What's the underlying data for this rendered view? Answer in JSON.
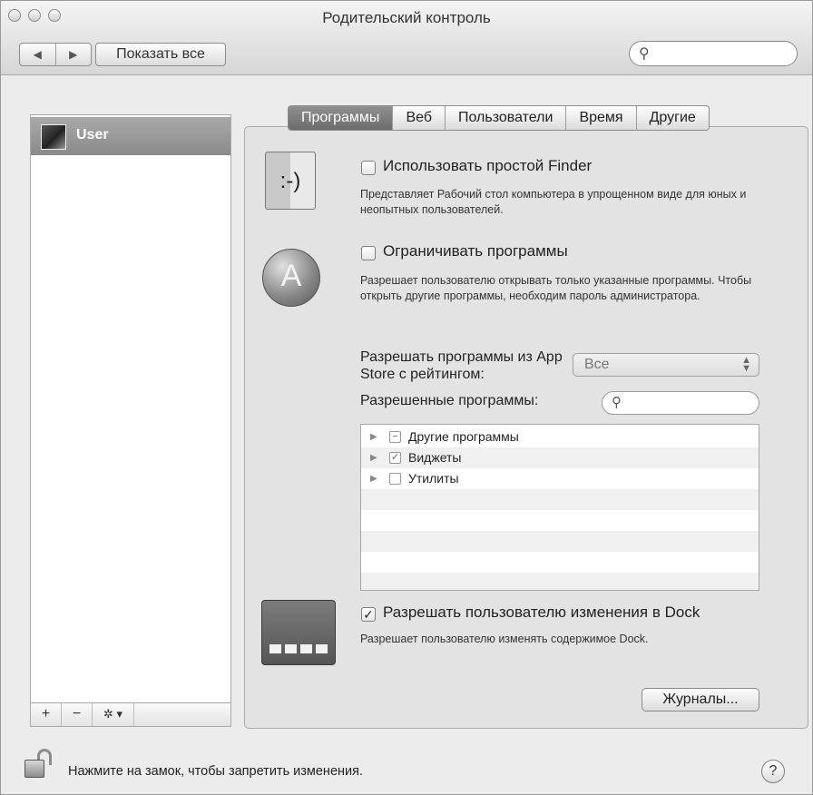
{
  "window": {
    "title": "Родительский контроль"
  },
  "toolbar": {
    "back_glyph": "◀",
    "forward_glyph": "▶",
    "show_all_label": "Показать все",
    "search_icon": "search-icon",
    "search_glyph": "⚲"
  },
  "users": {
    "items": [
      {
        "name": "User"
      }
    ],
    "add_label": "+",
    "remove_label": "−",
    "actions_label": "✲ ▾"
  },
  "tabs": [
    {
      "label": "Программы",
      "active": true
    },
    {
      "label": "Веб"
    },
    {
      "label": "Пользователи"
    },
    {
      "label": "Время"
    },
    {
      "label": "Другие"
    }
  ],
  "options": {
    "simple_finder": {
      "checked": false,
      "label": "Использовать простой Finder",
      "description": "Представляет Рабочий стол компьютера в упрощенном виде для юных и неопытных пользователей."
    },
    "limit_apps": {
      "checked": false,
      "label": "Ограничивать программы",
      "description": "Разрешает пользователю открывать только указанные программы. Чтобы открыть другие программы, необходим пароль администратора."
    },
    "dock_changes": {
      "checked": true,
      "label": "Разрешать пользователю изменения в Dock",
      "description": "Разрешает пользователю изменять содержимое Dock."
    }
  },
  "rating": {
    "label": "Разрешать программы из App Store с рейтингом:",
    "selected": "Все"
  },
  "allowed_apps": {
    "label": "Разрешенные программы:",
    "items": [
      {
        "name": "Другие программы",
        "state": "mixed",
        "mark": "−"
      },
      {
        "name": "Виджеты",
        "state": "checked",
        "mark": "✓"
      },
      {
        "name": "Утилиты",
        "state": "unchecked",
        "mark": ""
      }
    ]
  },
  "logs_button": "Журналы...",
  "footer": {
    "lock_text": "Нажмите на замок, чтобы запретить изменения.",
    "help_label": "?"
  },
  "glyphs": {
    "check": "✓",
    "finder_face": ":-)",
    "appstore": "A",
    "triangle": "▶"
  }
}
